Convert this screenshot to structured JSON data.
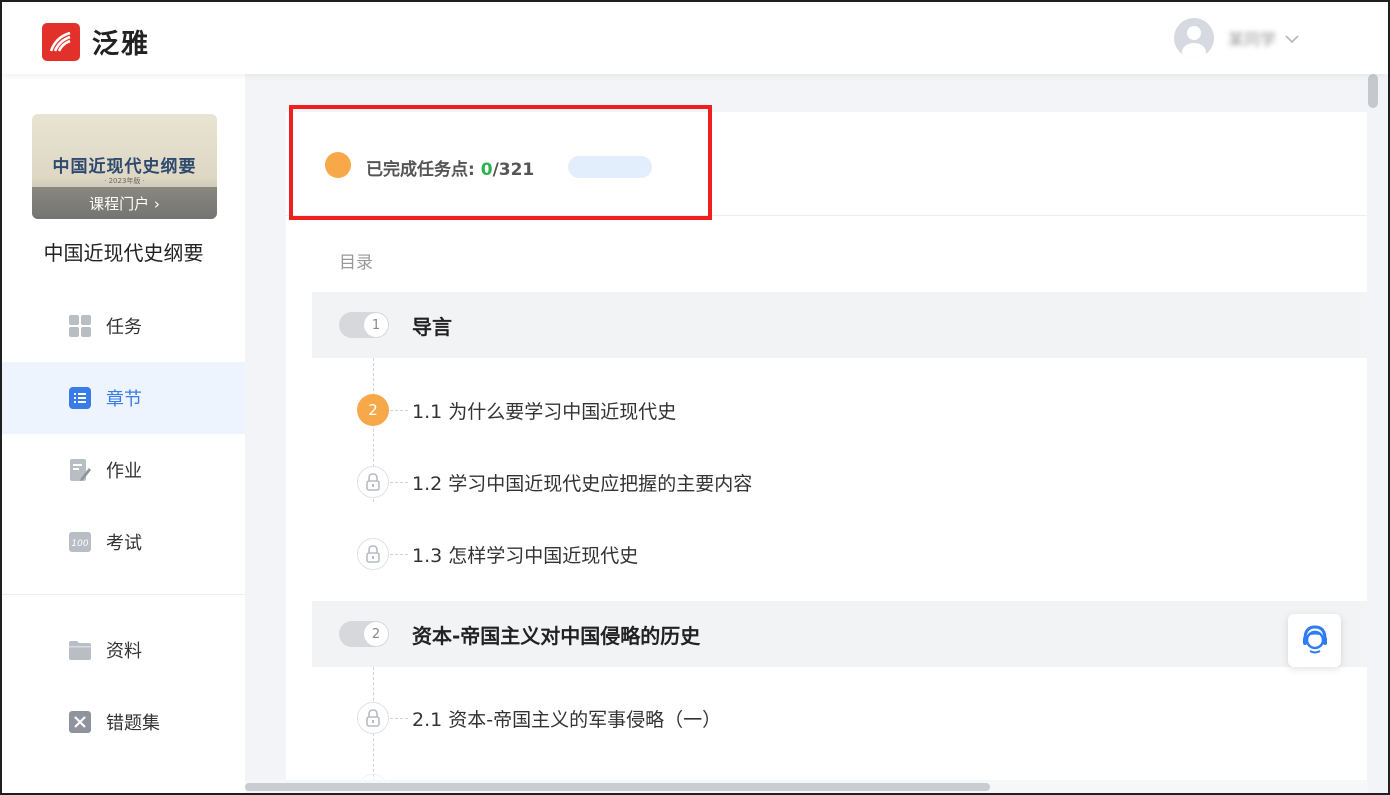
{
  "app": {
    "brand": "泛雅",
    "brand_color": "#e2312b",
    "accent": "#3a7bea"
  },
  "user": {
    "name": "某同学"
  },
  "course": {
    "cover_title": "中国近现代史纲要",
    "cover_subtitle": "· 2023年版 ·",
    "portal_label": "课程门户 ›",
    "name": "中国近现代史纲要"
  },
  "sidebar": {
    "items": [
      {
        "label": "任务",
        "icon": "grid-icon",
        "active": false
      },
      {
        "label": "章节",
        "icon": "list-icon",
        "active": true
      },
      {
        "label": "作业",
        "icon": "edit-icon",
        "active": false
      },
      {
        "label": "考试",
        "icon": "exam-icon",
        "active": false
      },
      {
        "label": "资料",
        "icon": "folder-icon",
        "active": false
      },
      {
        "label": "错题集",
        "icon": "wrong-icon",
        "active": false
      }
    ]
  },
  "progress": {
    "label": "已完成任务点: ",
    "done": "0",
    "total": "/321",
    "fraction": 0
  },
  "toc": {
    "label": "目录",
    "chapters": [
      {
        "num": "1",
        "title": "导言",
        "sections": [
          {
            "badge": "2",
            "locked": false,
            "title": "1.1 为什么要学习中国近现代史"
          },
          {
            "badge": "",
            "locked": true,
            "title": "1.2 学习中国近现代史应把握的主要内容"
          },
          {
            "badge": "",
            "locked": true,
            "title": "1.3 怎样学习中国近现代史"
          }
        ]
      },
      {
        "num": "2",
        "title": "资本-帝国主义对中国侵略的历史",
        "sections": [
          {
            "badge": "",
            "locked": true,
            "title": "2.1 资本-帝国主义的军事侵略（一）"
          }
        ]
      }
    ]
  }
}
